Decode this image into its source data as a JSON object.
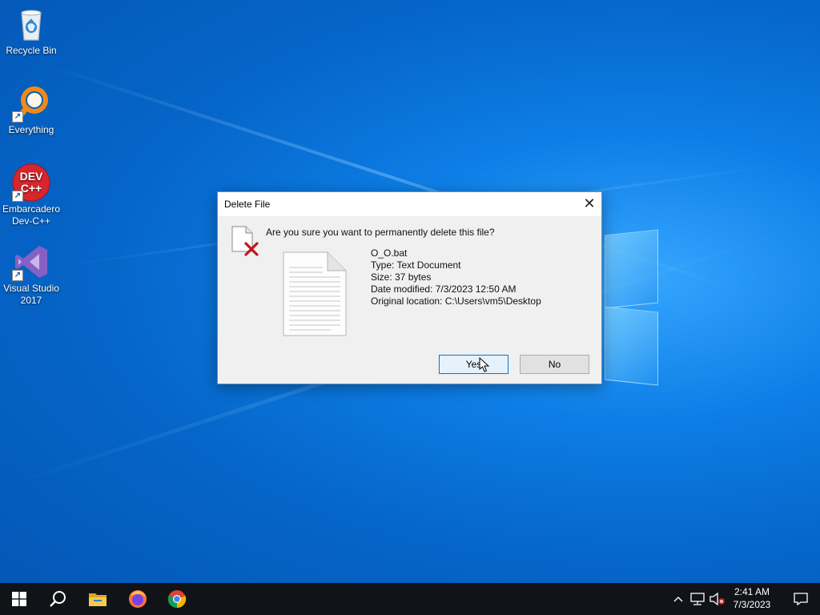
{
  "desktop": {
    "icons": [
      {
        "label": "Recycle Bin",
        "icon": "recycle-bin-icon"
      },
      {
        "label": "Everything",
        "icon": "everything-search-icon"
      },
      {
        "label": "Embarcadero Dev-C++",
        "icon": "devcpp-icon"
      },
      {
        "label": "Visual Studio 2017",
        "icon": "visual-studio-icon"
      }
    ],
    "devcpp_logo_line1": "DEV",
    "devcpp_logo_line2": "C++"
  },
  "dialog": {
    "title": "Delete File",
    "close_glyph": "✕",
    "question": "Are you sure you want to permanently delete this file?",
    "file": {
      "name": "O_O.bat",
      "type": "Type: Text Document",
      "size": "Size: 37 bytes",
      "modified": "Date modified: 7/3/2023 12:50 AM",
      "location": "Original location: C:\\Users\\vm5\\Desktop"
    },
    "yes_label": "Yes",
    "no_label": "No"
  },
  "taskbar": {
    "pinned": [
      "windows-start-icon",
      "search-icon",
      "file-explorer-icon",
      "firefox-icon",
      "chrome-icon"
    ],
    "tray": [
      "chevron-up-icon",
      "network-icon",
      "volume-muted-icon"
    ],
    "time": "2:41 AM",
    "date": "7/3/2023"
  },
  "colors": {
    "desktop_blue": "#0a6fd6",
    "taskbar": "#101419",
    "accent": "#0078d7",
    "delete_red": "#c4161c"
  }
}
